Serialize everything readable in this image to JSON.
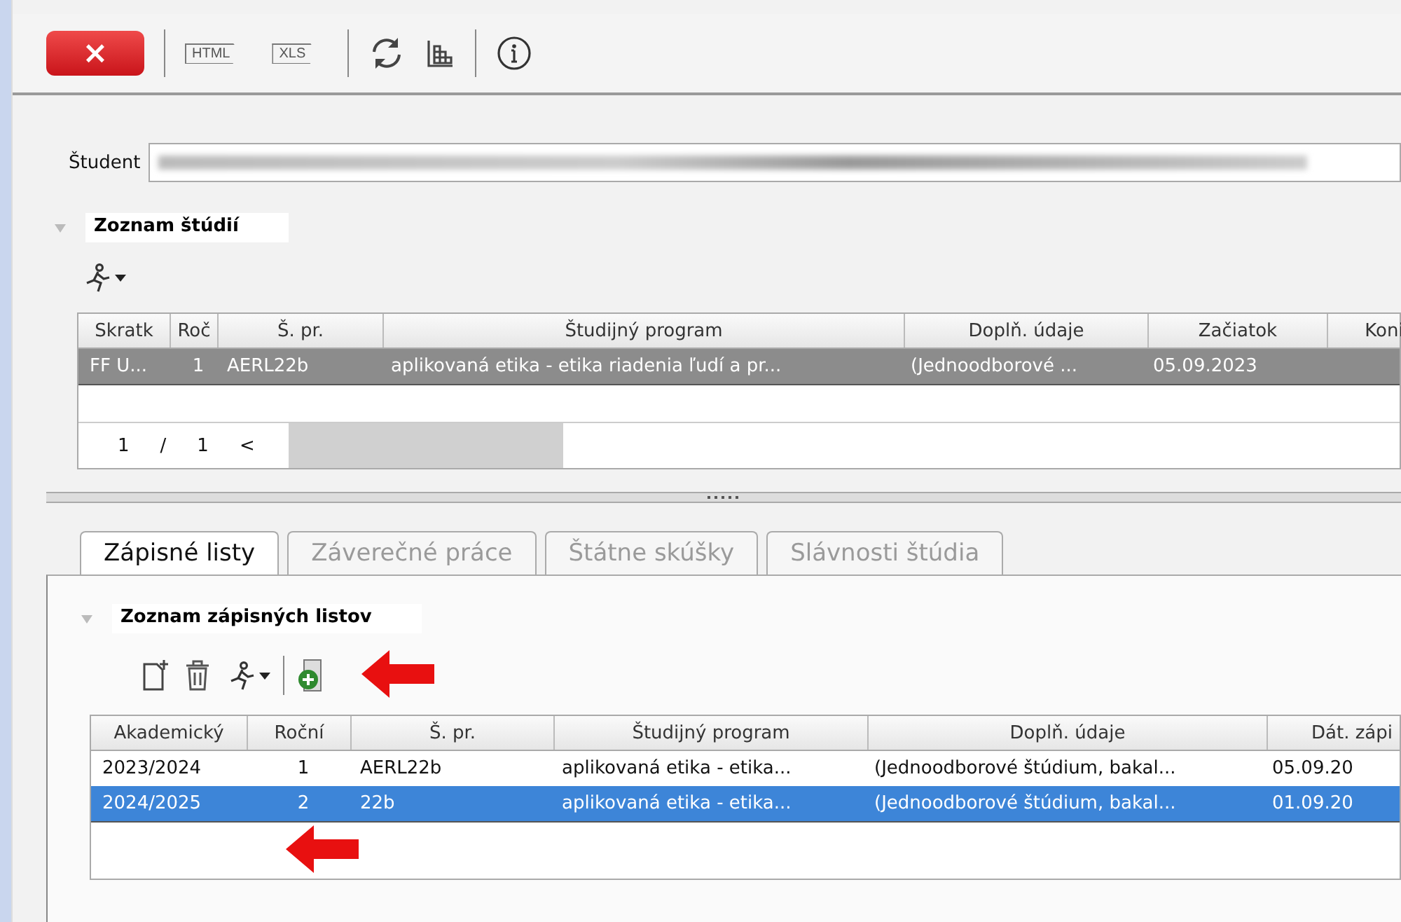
{
  "toolbar": {
    "buttons": [
      {
        "kind": "close",
        "label": "×"
      },
      {
        "kind": "sep"
      },
      {
        "kind": "html",
        "label": "HTML"
      },
      {
        "kind": "xls",
        "label": "XLS"
      },
      {
        "kind": "sep"
      },
      {
        "kind": "refresh"
      },
      {
        "kind": "grid"
      },
      {
        "kind": "sep"
      },
      {
        "kind": "info"
      }
    ]
  },
  "student": {
    "label": "Študent"
  },
  "studies": {
    "title": "Zoznam štúdií",
    "focused": false,
    "columns": [
      "Skratk",
      "Roč",
      "Š. pr.",
      "Študijný program",
      "Doplň. údaje",
      "Začiatok",
      "Koni"
    ],
    "rows": [
      {
        "selected": true,
        "cells": [
          "FF U...",
          "1",
          "AERL22b",
          "aplikovaná etika - etika riadenia ľudí a pr...",
          "(Jednoodborové ...",
          "05.09.2023",
          ""
        ]
      }
    ],
    "pager": [
      "1",
      "/",
      "1",
      "<"
    ]
  },
  "tabs": [
    {
      "label": "Zápisné listy",
      "selected": true
    },
    {
      "label": "Záverečné práce",
      "selected": false
    },
    {
      "label": "Štátne skúšky",
      "selected": false
    },
    {
      "label": "Slávnosti štúdia",
      "selected": false
    }
  ],
  "enrollments": {
    "title": "Zoznam zápisných listov",
    "focused": true,
    "columns": [
      "Akademický",
      "Roční",
      "Š. pr.",
      "Študijný program",
      "Doplň. údaje",
      "Dát. zápi"
    ],
    "rows": [
      {
        "selected": false,
        "cells": [
          "2023/2024",
          "1",
          "AERL22b",
          "aplikovaná etika - etika...",
          "(Jednoodborové štúdium, bakal...",
          "05.09.20"
        ]
      },
      {
        "selected": true,
        "cells": [
          "2024/2025",
          "2",
          "22b",
          "aplikovaná etika - etika...",
          "(Jednoodborové štúdium, bakal...",
          "01.09.20"
        ]
      }
    ]
  }
}
